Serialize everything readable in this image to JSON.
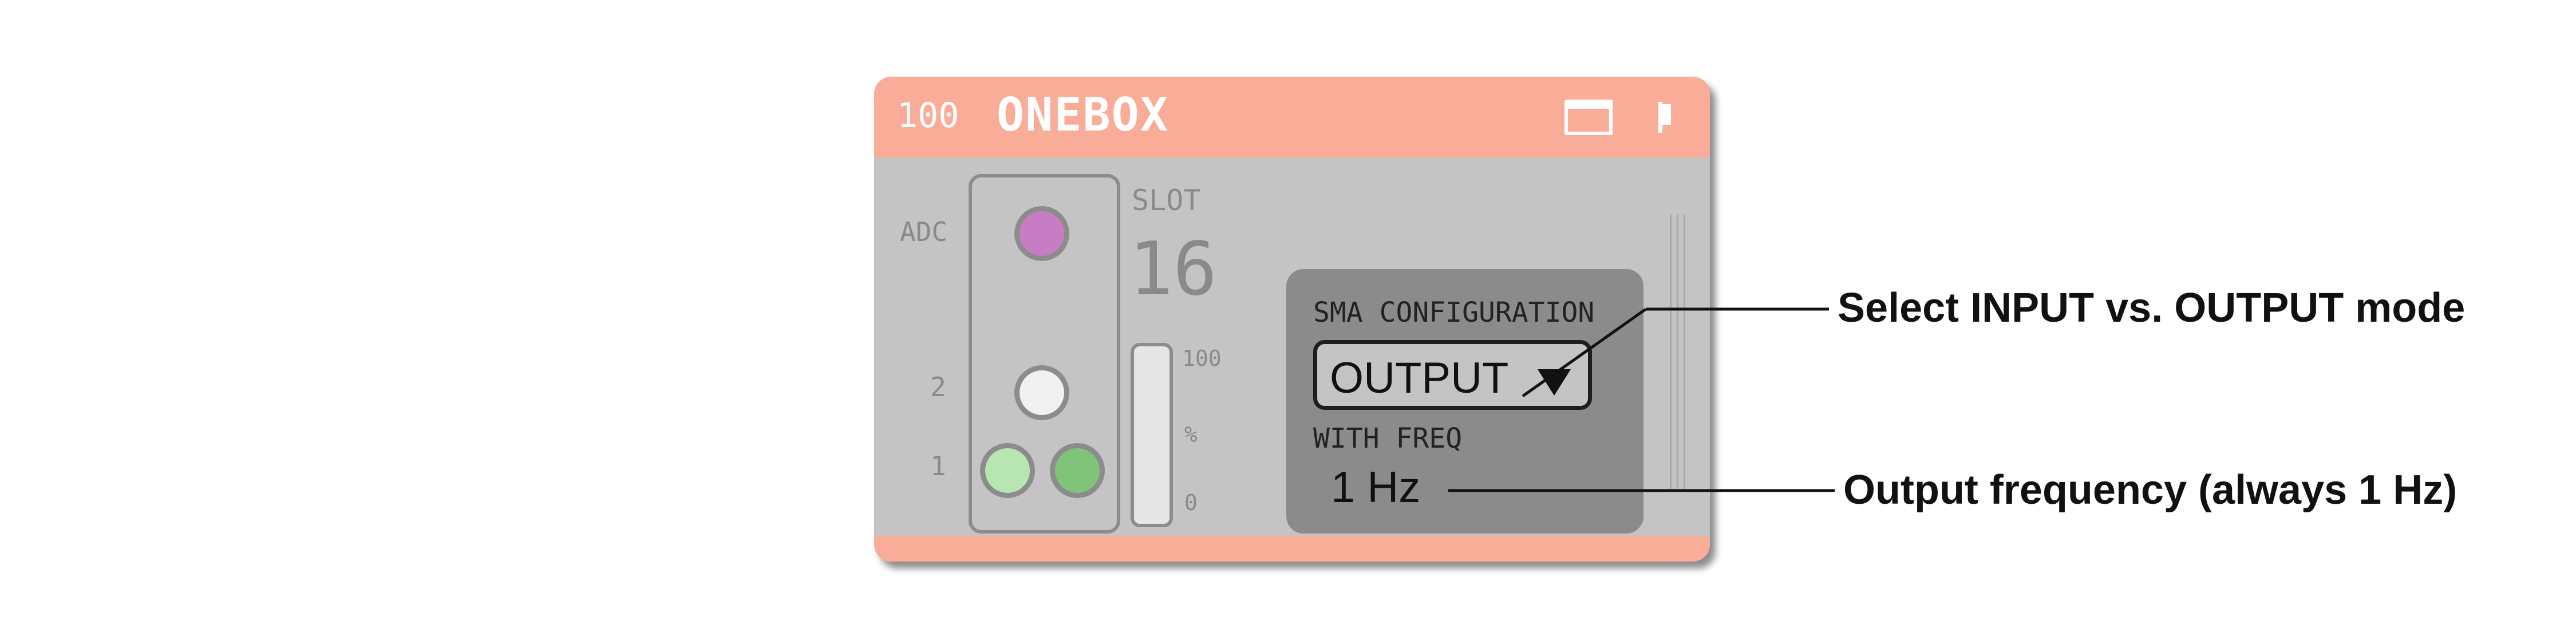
{
  "module": {
    "id": "100",
    "name": "ONEBOX",
    "window_icon": "window-icon",
    "flag_icon": "flag-icon",
    "colors": {
      "header": "#f9ad98",
      "body": "#c4c4c4",
      "panel": "#8b8b8b"
    }
  },
  "ports": {
    "adc_label": "ADC",
    "ch2_label": "2",
    "ch1_label": "1",
    "adc_color": "#c77cc3",
    "ch2_color": "#f1f1f1",
    "ch1_left_color": "#b8e6b3",
    "ch1_right_color": "#7fc479"
  },
  "slot": {
    "label": "SLOT",
    "value": "16"
  },
  "meter": {
    "max_label": "100",
    "unit_label": "%",
    "min_label": "0",
    "level": 0
  },
  "sma": {
    "title": "SMA CONFIGURATION",
    "mode": "OUTPUT",
    "freq_label": "WITH FREQ",
    "freq_value": "1 Hz"
  },
  "annotations": {
    "mode": "Select INPUT vs. OUTPUT mode",
    "freq": "Output frequency (always 1 Hz)"
  }
}
